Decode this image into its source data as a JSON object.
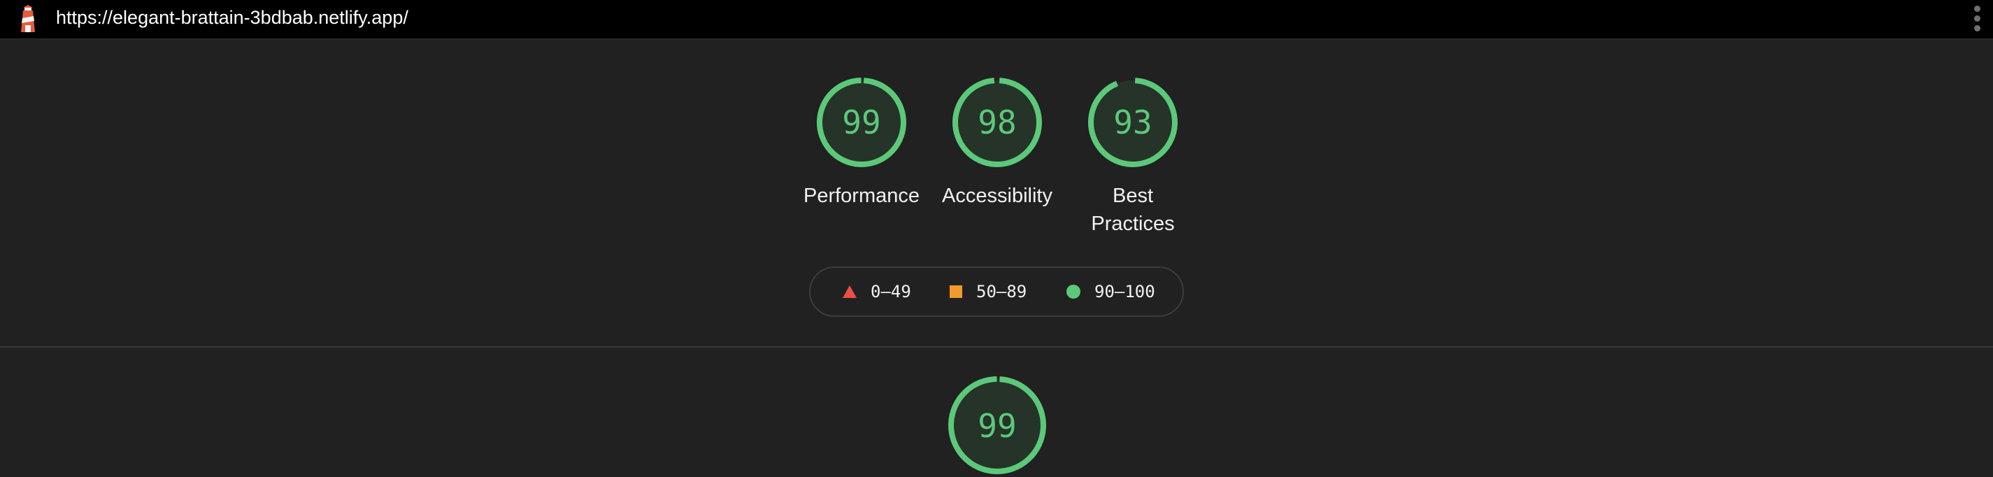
{
  "topbar": {
    "url": "https://elegant-brattain-3bdbab.netlify.app/",
    "logo_icon": "lighthouse-icon",
    "menu_icon": "kebab-menu-icon"
  },
  "gauges": [
    {
      "score": "99",
      "label": "Performance",
      "value": 0.99
    },
    {
      "score": "98",
      "label": "Accessibility",
      "value": 0.98
    },
    {
      "score": "93",
      "label_line1": "Best",
      "label_line2": "Practices",
      "value": 0.93
    }
  ],
  "legend": {
    "fail": {
      "range": "0–49",
      "color": "#eb4e47",
      "icon": "triangle-icon"
    },
    "average": {
      "range": "50–89",
      "color": "#f09b2c",
      "icon": "square-icon"
    },
    "pass": {
      "range": "90–100",
      "color": "#5cc97a",
      "icon": "circle-icon"
    }
  },
  "summary_gauge": {
    "score": "99",
    "value": 0.99
  },
  "colors": {
    "background": "#212121",
    "topbar": "#000000",
    "pass": "#5cc97a",
    "gauge_fill": "#263329"
  }
}
